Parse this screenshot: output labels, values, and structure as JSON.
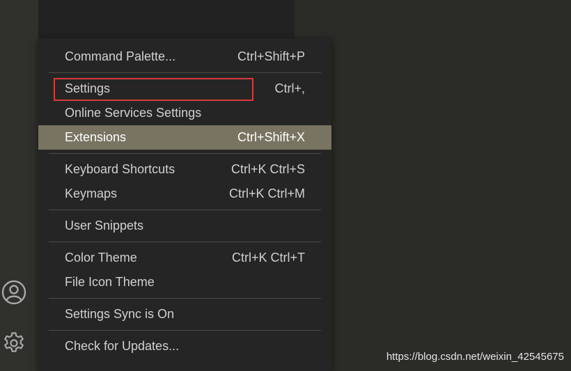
{
  "menu": {
    "items": [
      {
        "label": "Command Palette...",
        "shortcut": "Ctrl+Shift+P"
      },
      {
        "label": "Settings",
        "shortcut": "Ctrl+,"
      },
      {
        "label": "Online Services Settings",
        "shortcut": ""
      },
      {
        "label": "Extensions",
        "shortcut": "Ctrl+Shift+X"
      },
      {
        "label": "Keyboard Shortcuts",
        "shortcut": "Ctrl+K Ctrl+S"
      },
      {
        "label": "Keymaps",
        "shortcut": "Ctrl+K Ctrl+M"
      },
      {
        "label": "User Snippets",
        "shortcut": ""
      },
      {
        "label": "Color Theme",
        "shortcut": "Ctrl+K Ctrl+T"
      },
      {
        "label": "File Icon Theme",
        "shortcut": ""
      },
      {
        "label": "Settings Sync is On",
        "shortcut": ""
      },
      {
        "label": "Check for Updates...",
        "shortcut": ""
      }
    ]
  },
  "activity_bar": {
    "icons": [
      "account-icon",
      "manage-gear-icon"
    ]
  },
  "watermark": "https://blog.csdn.net/weixin_42545675",
  "colors": {
    "highlight_border": "#d93b3b",
    "active_item_bg": "#787461",
    "menu_bg": "#252525"
  }
}
